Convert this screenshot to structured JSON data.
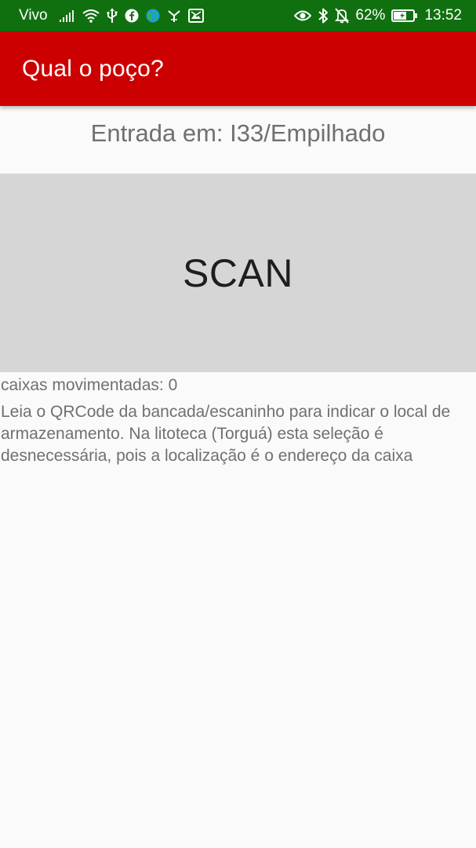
{
  "status_bar": {
    "carrier": "Vivo",
    "battery": "62%",
    "time": "13:52",
    "icons_left": [
      "signal-icon",
      "wifi-icon",
      "usb-icon",
      "facebook-icon",
      "globe-icon",
      "antenna-icon",
      "gallery-icon"
    ],
    "icons_right": [
      "eye-icon",
      "bluetooth-icon",
      "bell-off-icon",
      "battery-icon"
    ],
    "background_color": "#107010"
  },
  "app_bar": {
    "title": "Qual o poço?",
    "background_color": "#cc0000"
  },
  "main": {
    "entry_label": "Entrada em: I33/Empilhado",
    "scan_button_label": "SCAN",
    "moved_count_text": "caixas movimentadas: 0",
    "instructions": "Leia o QRCode da bancada/escaninho para indicar o local de armazenamento. Na litoteca (Torguá) esta seleção é desnecessária, pois a localização é o endereço da caixa"
  }
}
